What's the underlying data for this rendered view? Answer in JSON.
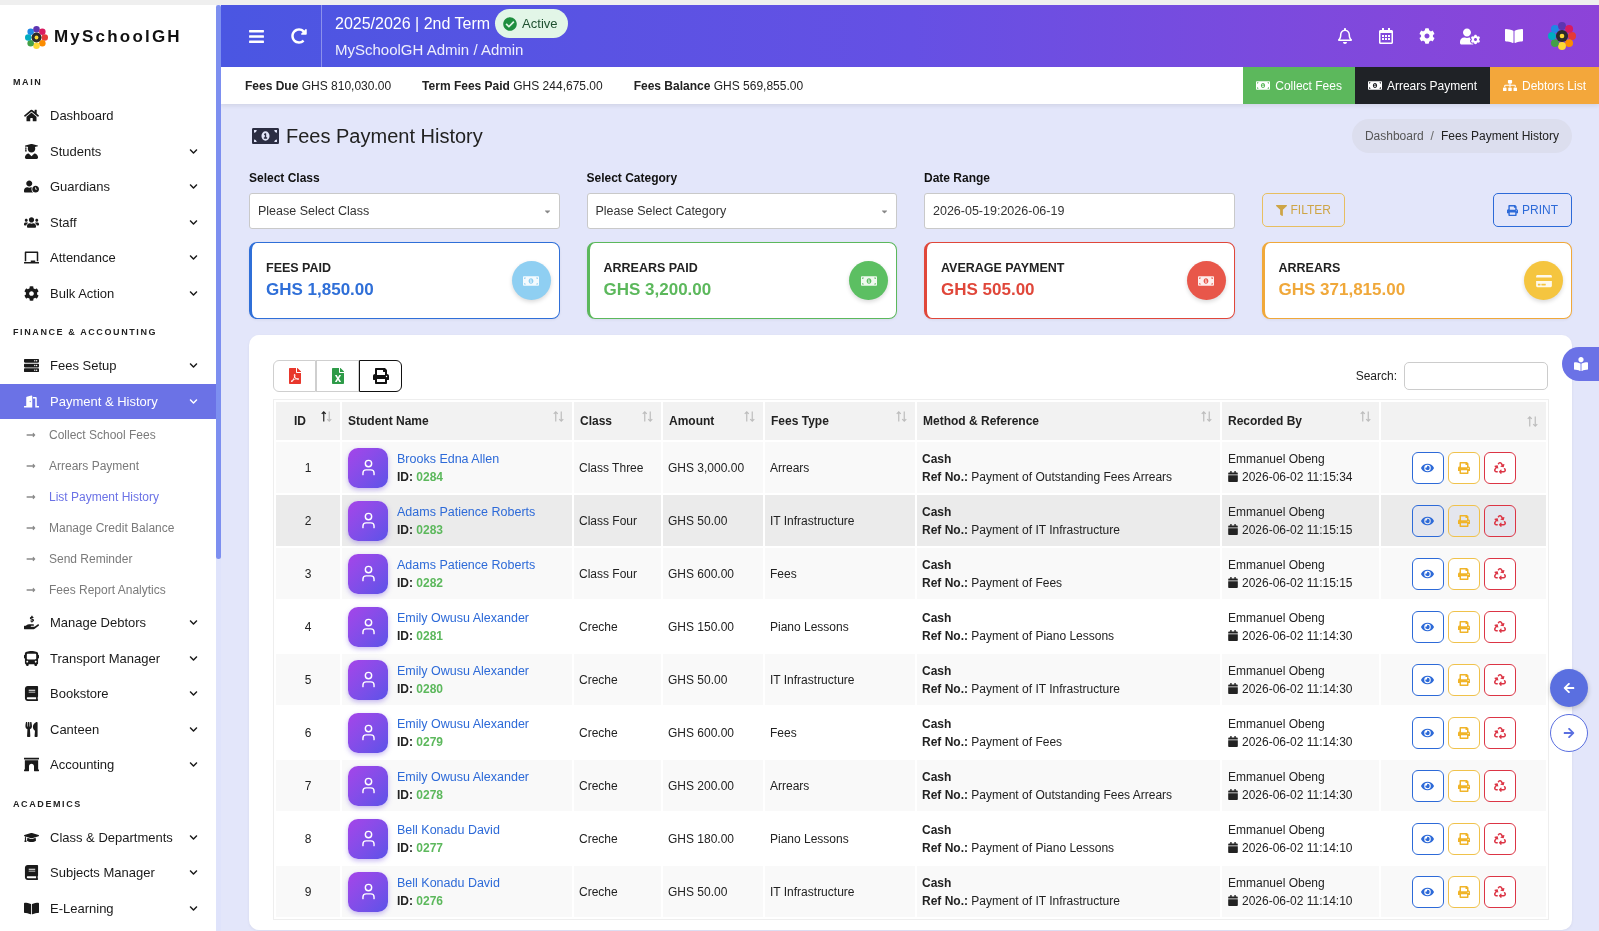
{
  "sidebar": {
    "brand": "MySchoolGH",
    "sections": [
      {
        "title": "MAIN",
        "items": [
          {
            "label": "Dashboard",
            "submenu": false,
            "selected": false
          },
          {
            "label": "Students",
            "submenu": true,
            "selected": false
          },
          {
            "label": "Guardians",
            "submenu": true,
            "selected": false
          },
          {
            "label": "Staff",
            "submenu": true,
            "selected": false
          },
          {
            "label": "Attendance",
            "submenu": true,
            "selected": false
          },
          {
            "label": "Bulk Action",
            "submenu": true,
            "selected": false
          }
        ]
      },
      {
        "title": "FINANCE & ACCOUNTING",
        "items": [
          {
            "label": "Fees Setup",
            "submenu": true,
            "selected": false
          },
          {
            "label": "Payment & History",
            "submenu": true,
            "selected": true,
            "children": [
              {
                "label": "Collect School Fees",
                "selected": false
              },
              {
                "label": "Arrears Payment",
                "selected": false
              },
              {
                "label": "List Payment History",
                "selected": true
              },
              {
                "label": "Manage Credit Balance",
                "selected": false
              },
              {
                "label": "Send Reminder",
                "selected": false
              },
              {
                "label": "Fees Report Analytics",
                "selected": false
              }
            ]
          },
          {
            "label": "Manage Debtors",
            "submenu": true,
            "selected": false
          },
          {
            "label": "Transport Manager",
            "submenu": true,
            "selected": false
          },
          {
            "label": "Bookstore",
            "submenu": true,
            "selected": false
          },
          {
            "label": "Canteen",
            "submenu": true,
            "selected": false
          },
          {
            "label": "Accounting",
            "submenu": true,
            "selected": false
          }
        ]
      },
      {
        "title": "ACADEMICS",
        "items": [
          {
            "label": "Class & Departments",
            "submenu": true,
            "selected": false
          },
          {
            "label": "Subjects Manager",
            "submenu": true,
            "selected": false
          },
          {
            "label": "E-Learning",
            "submenu": true,
            "selected": false
          }
        ]
      }
    ]
  },
  "header": {
    "term": "2025/2026 | 2nd Term",
    "status": "Active",
    "user": "MySchoolGH Admin / Admin"
  },
  "summary_bar": {
    "items": [
      {
        "label": "Fees Due",
        "value": "GHS 810,030.00"
      },
      {
        "label": "Term Fees Paid",
        "value": "GHS 244,675.00"
      },
      {
        "label": "Fees Balance",
        "value": "GHS 569,855.00"
      }
    ],
    "buttons": [
      {
        "label": "Collect Fees",
        "kind": "money",
        "color": "#5cb85c"
      },
      {
        "label": "Arrears Payment",
        "kind": "money",
        "color": "#1f2226"
      },
      {
        "label": "Debtors List",
        "kind": "network",
        "color": "#f3a73b"
      }
    ]
  },
  "page": {
    "title": "Fees Payment History",
    "breadcrumb": {
      "items": [
        "Dashboard",
        "Fees Payment History"
      ],
      "separator": "/"
    }
  },
  "filters": {
    "fields": [
      {
        "label": "Select Class",
        "kind": "select",
        "value": "Please Select Class"
      },
      {
        "label": "Select Category",
        "kind": "select",
        "value": "Please Select Category"
      },
      {
        "label": "Date Range",
        "kind": "text",
        "value": "2026-05-19:2026-06-19"
      }
    ],
    "buttons": [
      {
        "label": "FILTER",
        "kind": "filter",
        "disabled": true
      },
      {
        "label": "PRINT",
        "kind": "print",
        "disabled": false
      }
    ]
  },
  "stats": [
    {
      "title": "FEES PAID",
      "value": "GHS 1,850.00",
      "kind": "money",
      "color": "#2f6fd8",
      "icon": {
        "color": "#8fcff2"
      }
    },
    {
      "title": "ARREARS PAID",
      "value": "GHS 3,200.00",
      "kind": "money",
      "color": "#5cb85c",
      "icon": {
        "color": "#5cbf62"
      }
    },
    {
      "title": "AVERAGE PAYMENT",
      "value": "GHS 505.00",
      "kind": "money",
      "color": "#e0473a",
      "icon": {
        "color": "#e8574a"
      }
    },
    {
      "title": "ARREARS",
      "value": "GHS 371,815.00",
      "kind": "card",
      "color": "#f0a83a",
      "icon": {
        "color": "#f5c53f"
      }
    }
  ],
  "table": {
    "export_buttons": [
      {
        "kind": "pdf",
        "focused": false
      },
      {
        "kind": "excel",
        "focused": false
      },
      {
        "kind": "print",
        "focused": true
      }
    ],
    "search_label": "Search:",
    "columns": [
      {
        "label": "ID",
        "sorted": true
      },
      {
        "label": "Student Name",
        "sorted": false
      },
      {
        "label": "Class",
        "sorted": false
      },
      {
        "label": "Amount",
        "sorted": false
      },
      {
        "label": "Fees Type",
        "sorted": false
      },
      {
        "label": "Method & Reference",
        "sorted": false
      },
      {
        "label": "Recorded By",
        "sorted": false
      },
      {
        "sorted": false
      }
    ],
    "rows": [
      {
        "no": "1",
        "name": "Brooks Edna Allen",
        "id_label": "ID:",
        "student_id": "0284",
        "class": "Class Three",
        "amount": "GHS 3,000.00",
        "fees_type": "Arrears",
        "method": "Cash",
        "ref_label": "Ref No.:",
        "reference": "Payment of Outstanding Fees Arrears",
        "recorded_by": "Emmanuel Obeng",
        "recorded_at": "2026-06-02 11:15:34",
        "selected": false
      },
      {
        "no": "2",
        "name": "Adams Patience Roberts",
        "id_label": "ID:",
        "student_id": "0283",
        "class": "Class Four",
        "amount": "GHS 50.00",
        "fees_type": "IT Infrastructure",
        "method": "Cash",
        "ref_label": "Ref No.:",
        "reference": "Payment of IT Infrastructure",
        "recorded_by": "Emmanuel Obeng",
        "recorded_at": "2026-06-02 11:15:15",
        "selected": true
      },
      {
        "no": "3",
        "name": "Adams Patience Roberts",
        "id_label": "ID:",
        "student_id": "0282",
        "class": "Class Four",
        "amount": "GHS 600.00",
        "fees_type": "Fees",
        "method": "Cash",
        "ref_label": "Ref No.:",
        "reference": "Payment of Fees",
        "recorded_by": "Emmanuel Obeng",
        "recorded_at": "2026-06-02 11:15:15",
        "selected": false
      },
      {
        "no": "4",
        "name": "Emily Owusu Alexander",
        "id_label": "ID:",
        "student_id": "0281",
        "class": "Creche",
        "amount": "GHS 150.00",
        "fees_type": "Piano Lessons",
        "method": "Cash",
        "ref_label": "Ref No.:",
        "reference": "Payment of Piano Lessons",
        "recorded_by": "Emmanuel Obeng",
        "recorded_at": "2026-06-02 11:14:30",
        "selected": false
      },
      {
        "no": "5",
        "name": "Emily Owusu Alexander",
        "id_label": "ID:",
        "student_id": "0280",
        "class": "Creche",
        "amount": "GHS 50.00",
        "fees_type": "IT Infrastructure",
        "method": "Cash",
        "ref_label": "Ref No.:",
        "reference": "Payment of IT Infrastructure",
        "recorded_by": "Emmanuel Obeng",
        "recorded_at": "2026-06-02 11:14:30",
        "selected": false
      },
      {
        "no": "6",
        "name": "Emily Owusu Alexander",
        "id_label": "ID:",
        "student_id": "0279",
        "class": "Creche",
        "amount": "GHS 600.00",
        "fees_type": "Fees",
        "method": "Cash",
        "ref_label": "Ref No.:",
        "reference": "Payment of Fees",
        "recorded_by": "Emmanuel Obeng",
        "recorded_at": "2026-06-02 11:14:30",
        "selected": false
      },
      {
        "no": "7",
        "name": "Emily Owusu Alexander",
        "id_label": "ID:",
        "student_id": "0278",
        "class": "Creche",
        "amount": "GHS 200.00",
        "fees_type": "Arrears",
        "method": "Cash",
        "ref_label": "Ref No.:",
        "reference": "Payment of Outstanding Fees Arrears",
        "recorded_by": "Emmanuel Obeng",
        "recorded_at": "2026-06-02 11:14:30",
        "selected": false
      },
      {
        "no": "8",
        "name": "Bell Konadu David",
        "id_label": "ID:",
        "student_id": "0277",
        "class": "Creche",
        "amount": "GHS 180.00",
        "fees_type": "Piano Lessons",
        "method": "Cash",
        "ref_label": "Ref No.:",
        "reference": "Payment of Piano Lessons",
        "recorded_by": "Emmanuel Obeng",
        "recorded_at": "2026-06-02 11:14:10",
        "selected": false
      },
      {
        "no": "9",
        "name": "Bell Konadu David",
        "id_label": "ID:",
        "student_id": "0276",
        "class": "Creche",
        "amount": "GHS 50.00",
        "fees_type": "IT Infrastructure",
        "method": "Cash",
        "ref_label": "Ref No.:",
        "reference": "Payment of IT Infrastructure",
        "recorded_by": "Emmanuel Obeng",
        "recorded_at": "2026-06-02 11:14:10",
        "selected": false
      }
    ]
  }
}
